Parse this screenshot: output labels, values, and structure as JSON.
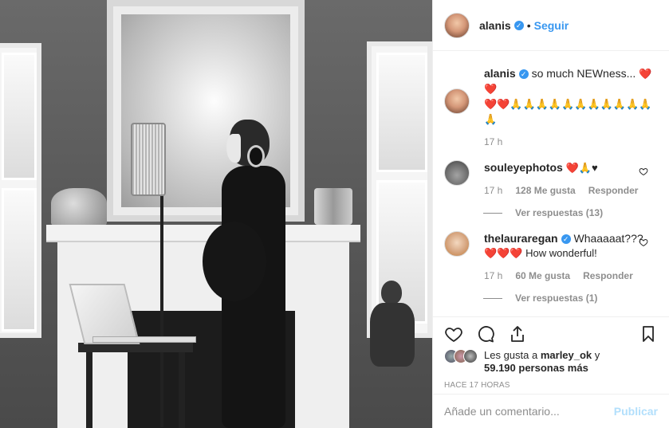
{
  "header": {
    "username": "alanis",
    "separator": "•",
    "follow_label": "Seguir"
  },
  "caption": {
    "username": "alanis",
    "text": "so much NEWness...",
    "emoji_line1": "❤️❤️",
    "emoji_line2": "❤️❤️🙏🙏🙏🙏🙏🙏🙏🙏🙏🙏🙏",
    "emoji_line3": "🙏",
    "time": "17 h"
  },
  "comments": [
    {
      "username": "souleyephotos",
      "text": "❤️🙏♥",
      "time": "17 h",
      "likes": "128 Me gusta",
      "reply_label": "Responder",
      "view_replies": "Ver respuestas (13)"
    },
    {
      "username": "thelauraregan",
      "text": "Whaaaaat???",
      "text2": "❤️❤️❤️ How wonderful!",
      "time": "17 h",
      "likes": "60 Me gusta",
      "reply_label": "Responder",
      "view_replies": "Ver respuestas (1)"
    }
  ],
  "likes_summary": {
    "prefix": "Les gusta a",
    "user": "marley_ok",
    "conj": "y",
    "count": "59.190 personas más"
  },
  "post_time": "HACE 17 HORAS",
  "add_comment": {
    "placeholder": "Añade un comentario...",
    "post_label": "Publicar"
  },
  "colors": {
    "accent": "#3897f0",
    "text": "#262626",
    "muted": "#8e8e8e",
    "post_disabled": "#b2dffc"
  }
}
